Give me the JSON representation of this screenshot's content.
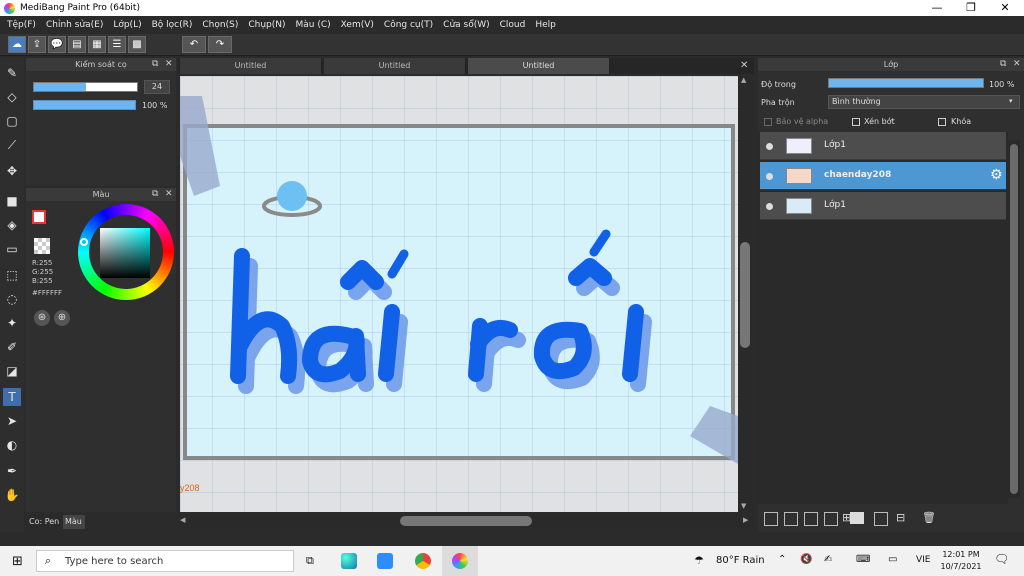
{
  "window": {
    "title": "MediBang Paint Pro (64bit)",
    "minimize": "—",
    "maximize": "❐",
    "close": "✕"
  },
  "menu": [
    "Tệp(F)",
    "Chỉnh sửa(E)",
    "Lớp(L)",
    "Bộ lọc(R)",
    "Chọn(S)",
    "Chụp(N)",
    "Màu (C)",
    "Xem(V)",
    "Công cụ(T)",
    "Cửa sổ(W)",
    "Cloud",
    "Help"
  ],
  "brush_panel": {
    "title": "Kiểm soát cọ",
    "size_value": "24",
    "opacity_value": "100 %",
    "size_fraction": 0.5,
    "opacity_fraction": 1.0
  },
  "color_panel": {
    "title": "Màu",
    "r": "R:255",
    "g": "G:255",
    "b": "B:255",
    "hex": "#FFFFFF"
  },
  "bottom_tabs": {
    "pen": "Co: Pen",
    "color": "Màu"
  },
  "document_tabs": [
    "Untitled",
    "Untitled",
    "Untitled"
  ],
  "canvas": {
    "bg_color": "#d6f3fb",
    "text_color": "#1160e8",
    "watermark": "y208"
  },
  "layer_panel": {
    "title": "Lớp",
    "opacity_label": "Độ trong",
    "opacity_value": "100 %",
    "opacity_fraction": 1.0,
    "blend_label": "Pha trộn",
    "blend_value": "Bình thường",
    "protect_alpha": "Bảo vệ alpha",
    "clipping": "Xén bớt",
    "lock": "Khóa",
    "layers": [
      {
        "name": "Lớp1"
      },
      {
        "name": "chaenday208"
      },
      {
        "name": "Lớp1"
      }
    ]
  },
  "taskbar": {
    "search": "Type here to search",
    "weather": "80°F  Rain",
    "lang": "VIE",
    "time": "12:01 PM",
    "date": "10/7/2021"
  }
}
